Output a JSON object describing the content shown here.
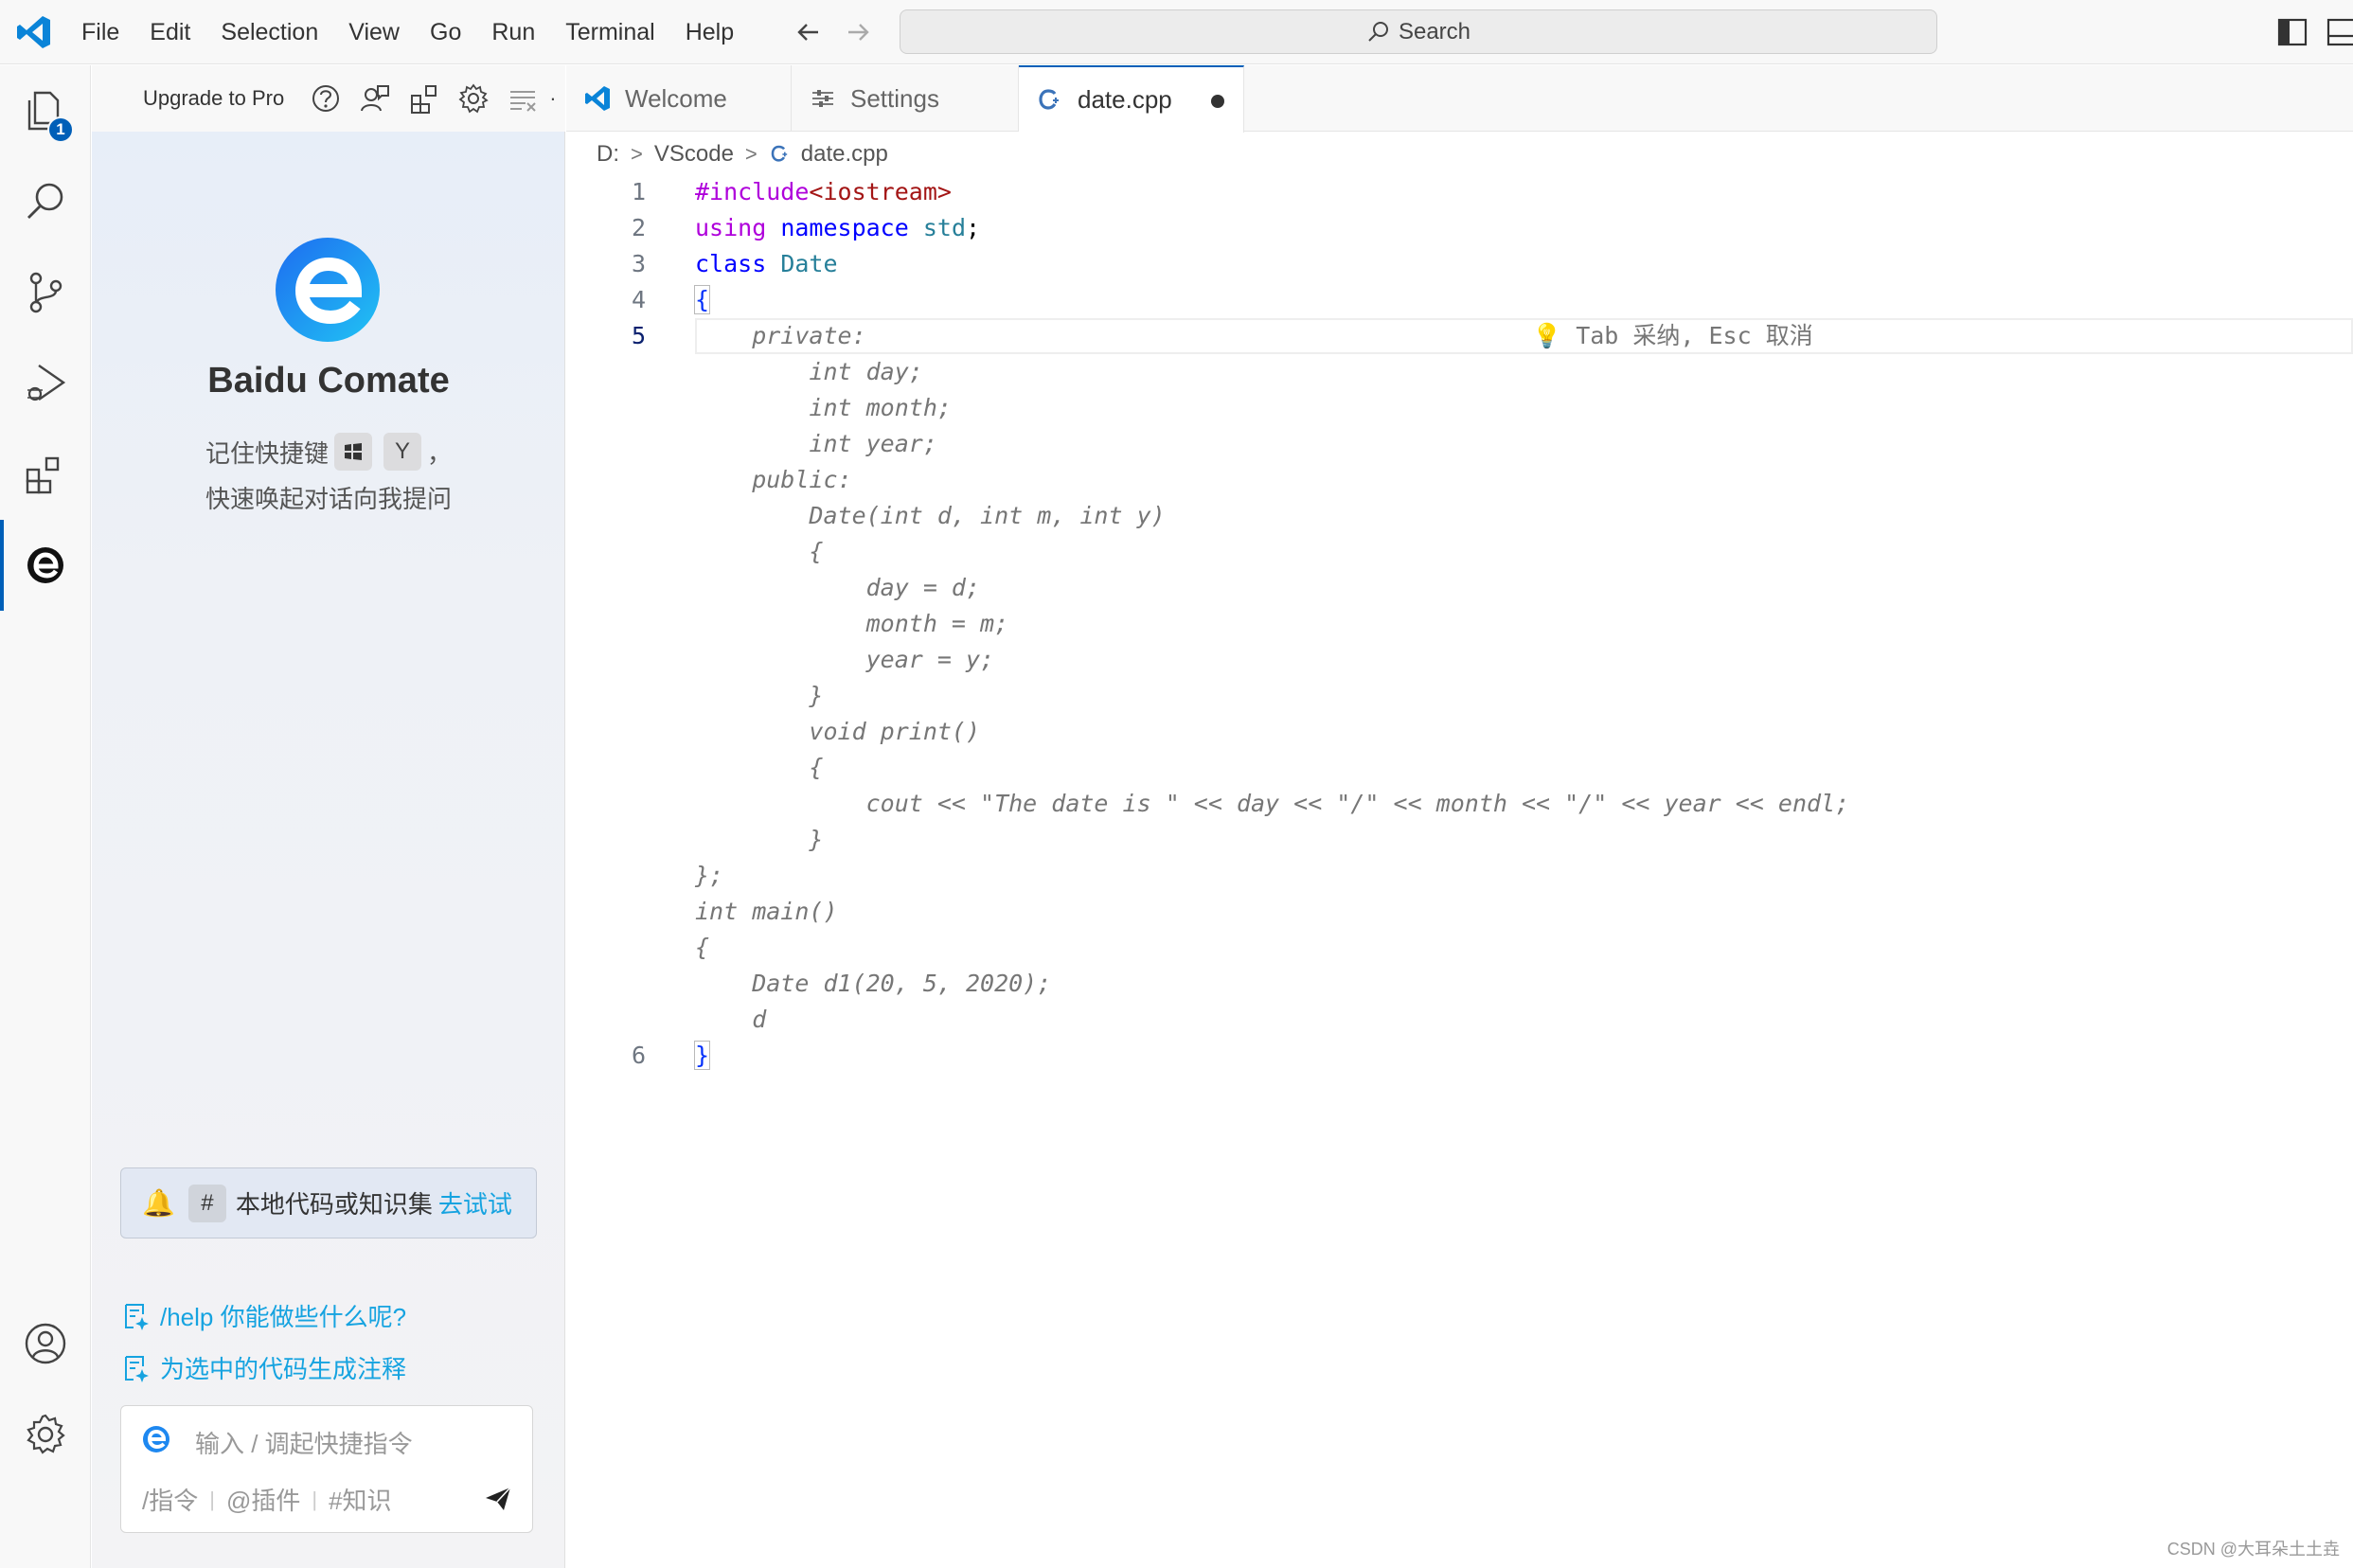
{
  "titlebar": {
    "menu": [
      "File",
      "Edit",
      "Selection",
      "View",
      "Go",
      "Run",
      "Terminal",
      "Help"
    ],
    "search_placeholder": "Search"
  },
  "activitybar": {
    "explorer_badge": "1",
    "items": [
      "explorer",
      "search",
      "source-control",
      "run-debug",
      "extensions",
      "baidu-comate"
    ],
    "bottom": [
      "accounts",
      "manage"
    ]
  },
  "sidepanel": {
    "upgrade_label": "Upgrade to Pro",
    "title": "Baidu Comate",
    "hint_prefix": "记住快捷键",
    "hint_key": "Y",
    "hint_suffix": "，",
    "hint_line2": "快速唤起对话向我提问",
    "notice": {
      "hash": "#",
      "text": "本地代码或知识集",
      "link": "去试试"
    },
    "quick_actions": [
      "/help 你能做些什么呢?",
      "为选中的代码生成注释"
    ],
    "input": {
      "placeholder": "输入 / 调起快捷指令",
      "tags": [
        "/指令",
        "@插件",
        "#知识"
      ]
    }
  },
  "tabs": [
    {
      "label": "Welcome",
      "icon": "vscode-icon",
      "active": false
    },
    {
      "label": "Settings",
      "icon": "settings-sliders-icon",
      "active": false
    },
    {
      "label": "date.cpp",
      "icon": "cpp-file-icon",
      "active": true,
      "dirty": true
    }
  ],
  "breadcrumb": [
    "D:",
    "VScode",
    "date.cpp"
  ],
  "code": {
    "line_numbers": [
      "1",
      "2",
      "3",
      "4",
      "5",
      "6"
    ],
    "l1_pp": "#include",
    "l1_inc": "<iostream>",
    "l2_kw1": "using",
    "l2_kw2": "namespace",
    "l2_ns": "std",
    "l2_end": ";",
    "l3_kw": "class",
    "l3_name": "Date",
    "l4": "{",
    "l5_ghost": "    private:",
    "l5_hint": "Tab 采纳, Esc 取消",
    "ghost_lines": [
      "        int day;",
      "        int month;",
      "        int year;",
      "    public:",
      "        Date(int d, int m, int y)",
      "        {",
      "            day = d;",
      "            month = m;",
      "            year = y;",
      "        }",
      "        void print()",
      "        {",
      "            cout << \"The date is \" << day << \"/\" << month << \"/\" << year << endl;",
      "        }",
      "};",
      "int main()",
      "{",
      "    Date d1(20, 5, 2020);",
      "    d"
    ],
    "l6": "}"
  },
  "watermark": "CSDN @大耳朵土土垚",
  "colors": {
    "accent": "#005fb8",
    "link": "#16a3e0",
    "keyword": "#0000ff",
    "preprocessor": "#af00db",
    "include_string": "#a31515",
    "type": "#267f99"
  }
}
